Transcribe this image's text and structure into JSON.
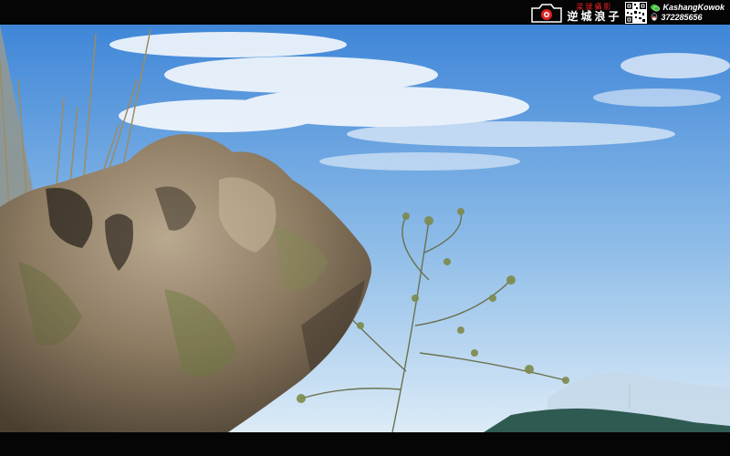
{
  "watermark": {
    "chinese_small": "梁號攝影",
    "chinese_big": "逆城浪子",
    "wechat_id": "KashangKowok",
    "qq_number": "372285656",
    "accent_color": "#e22222"
  },
  "scene": {
    "subject": "boulder",
    "sky_color_top": "#3f86d8",
    "sky_color_horizon": "#dcebf7",
    "hill_color": "#2f5a52"
  }
}
